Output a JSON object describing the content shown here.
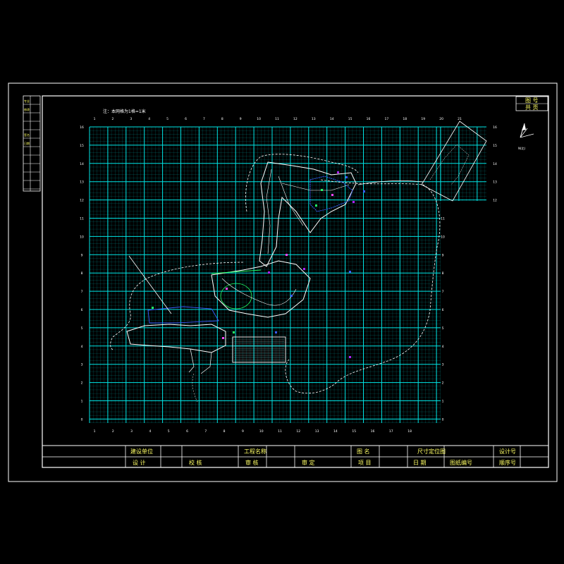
{
  "drawing": {
    "note": "注：本网格为1格=1米",
    "north_label": "N(北)",
    "grid_top_labels": [
      "1",
      "2",
      "3",
      "4",
      "5",
      "6",
      "7",
      "8",
      "9",
      "10",
      "11",
      "12",
      "13",
      "14",
      "15",
      "16",
      "17",
      "18",
      "19",
      "20",
      "21"
    ],
    "grid_bottom_labels": [
      "1",
      "2",
      "3",
      "4",
      "5",
      "6",
      "7",
      "8",
      "9",
      "10",
      "11",
      "12",
      "13",
      "14",
      "15",
      "16",
      "17",
      "18"
    ],
    "grid_left_labels": [
      "16",
      "15",
      "14",
      "13",
      "12",
      "11",
      "10",
      "9",
      "8",
      "7",
      "6",
      "5",
      "4",
      "3",
      "2",
      "1",
      "0"
    ],
    "grid_right_labels": [
      "16",
      "15",
      "14",
      "13",
      "12",
      "11",
      "10",
      "9",
      "8",
      "7",
      "6",
      "5",
      "4",
      "3",
      "2",
      "1",
      "0"
    ],
    "grid_color": "#00e5e5",
    "plan_color": "#ffffff",
    "accent_colors": [
      "#b020ff",
      "#3a5cff",
      "#22ff66",
      "#ff44ff"
    ]
  },
  "side_table": {
    "rows": [
      "专业",
      "修改",
      "",
      "",
      "签名",
      "日期",
      "",
      "",
      "",
      "",
      ""
    ]
  },
  "corner_box": {
    "row1": "图 号",
    "row2": "共 页"
  },
  "title_block": {
    "build_unit": "建设单位",
    "project_name": "工程名称",
    "drawing_name_label": "图 名",
    "drawing_name": "尺寸定位图",
    "design_no_label": "设计号",
    "design": "设 计",
    "check": "校 核",
    "review": "审 核",
    "approve": "审 定",
    "project_head": "项 目",
    "date": "日 期",
    "sheet_no": "图纸编号",
    "serial_no": "顺序号"
  }
}
